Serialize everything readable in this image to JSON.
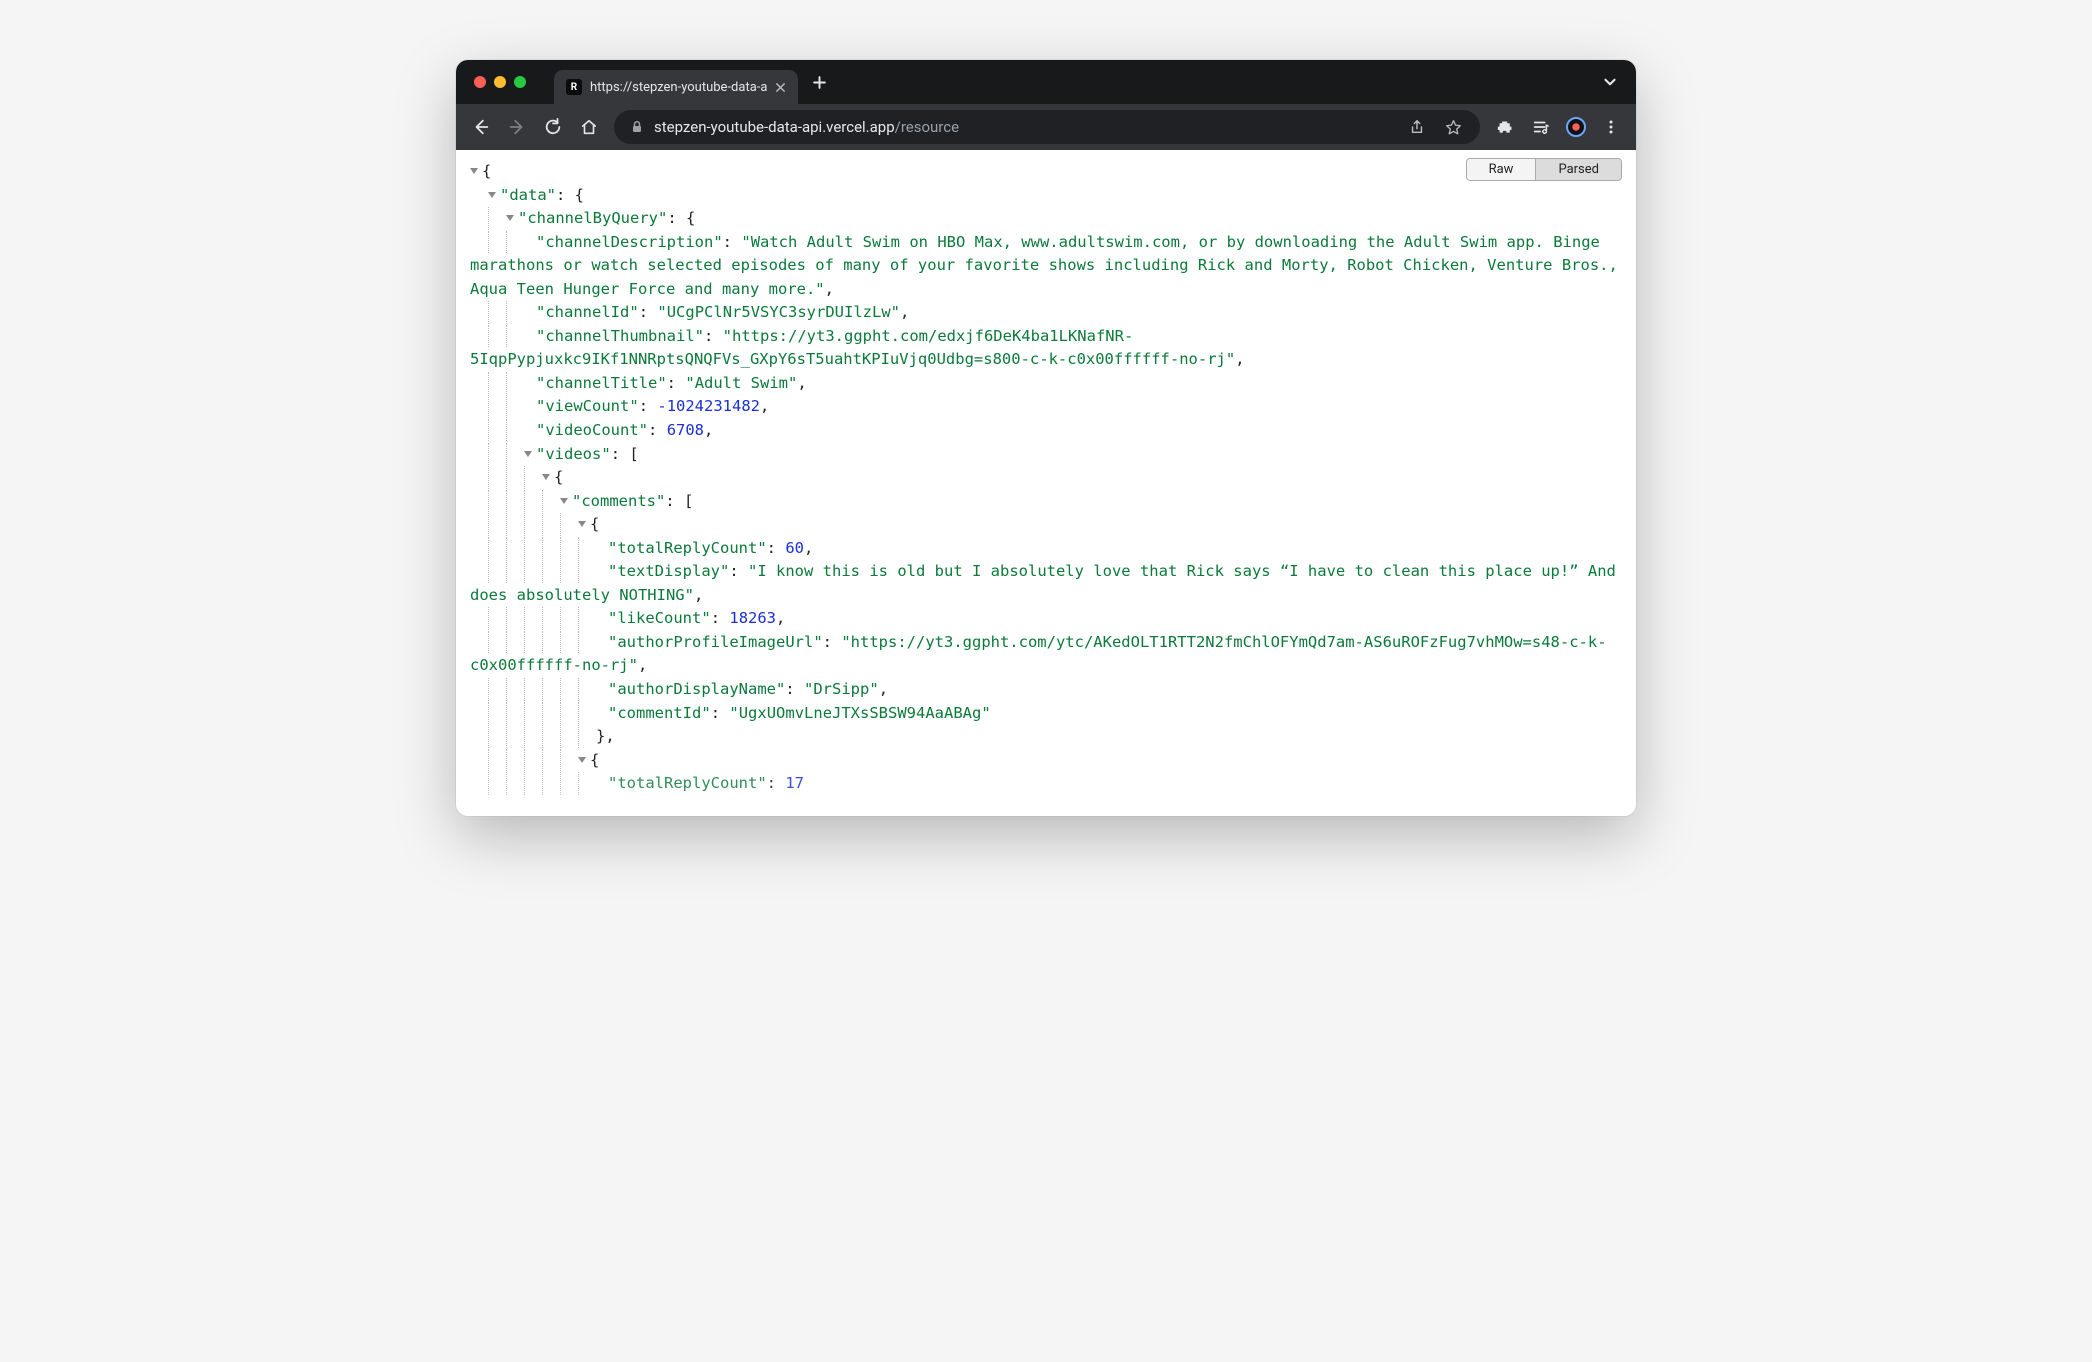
{
  "tab": {
    "title": "https://stepzen-youtube-data-a",
    "favicon_glyph": "R"
  },
  "address": {
    "host": "stepzen-youtube-data-api.vercel.app",
    "path": "/resource"
  },
  "view_toggle": {
    "raw_label": "Raw",
    "parsed_label": "Parsed",
    "active": "parsed"
  },
  "json": {
    "root_key": "data",
    "channel_key": "channelByQuery",
    "fields": {
      "channelDescription": {
        "key": "channelDescription",
        "value": "Watch Adult Swim on HBO Max, www.adultswim.com, or by downloading the Adult Swim app. Binge marathons or watch selected episodes of many of your favorite shows including Rick and Morty, Robot Chicken, Venture Bros., Aqua Teen Hunger Force and many more."
      },
      "channelId": {
        "key": "channelId",
        "value": "UCgPClNr5VSYC3syrDUIlzLw"
      },
      "channelThumbnail": {
        "key": "channelThumbnail",
        "value": "https://yt3.ggpht.com/edxjf6DeK4ba1LKNafNR-5IqpPypjuxkc9IKf1NNRptsQNQFVs_GXpY6sT5uahtKPIuVjq0Udbg=s800-c-k-c0x00ffffff-no-rj"
      },
      "channelTitle": {
        "key": "channelTitle",
        "value": "Adult Swim"
      },
      "viewCount": {
        "key": "viewCount",
        "value": "-1024231482"
      },
      "videoCount": {
        "key": "videoCount",
        "value": "6708"
      },
      "videos": {
        "key": "videos"
      },
      "comments": {
        "key": "comments"
      },
      "comment0": {
        "totalReplyCount": {
          "key": "totalReplyCount",
          "value": "60"
        },
        "textDisplay": {
          "key": "textDisplay",
          "value": "I know this is old but I absolutely love that Rick says “I have to clean this place up!” And does absolutely NOTHING"
        },
        "likeCount": {
          "key": "likeCount",
          "value": "18263"
        },
        "authorProfileImageUrl": {
          "key": "authorProfileImageUrl",
          "value": "https://yt3.ggpht.com/ytc/AKedOLT1RTT2N2fmChlOFYmQd7am-AS6uROFzFug7vhMOw=s48-c-k-c0x00ffffff-no-rj"
        },
        "authorDisplayName": {
          "key": "authorDisplayName",
          "value": "DrSipp"
        },
        "commentId": {
          "key": "commentId",
          "value": "UgxUOmvLneJTXsSBSW94AaABAg"
        }
      },
      "comment1": {
        "totalReplyCount": {
          "key": "totalReplyCount",
          "value": "17"
        }
      }
    }
  }
}
